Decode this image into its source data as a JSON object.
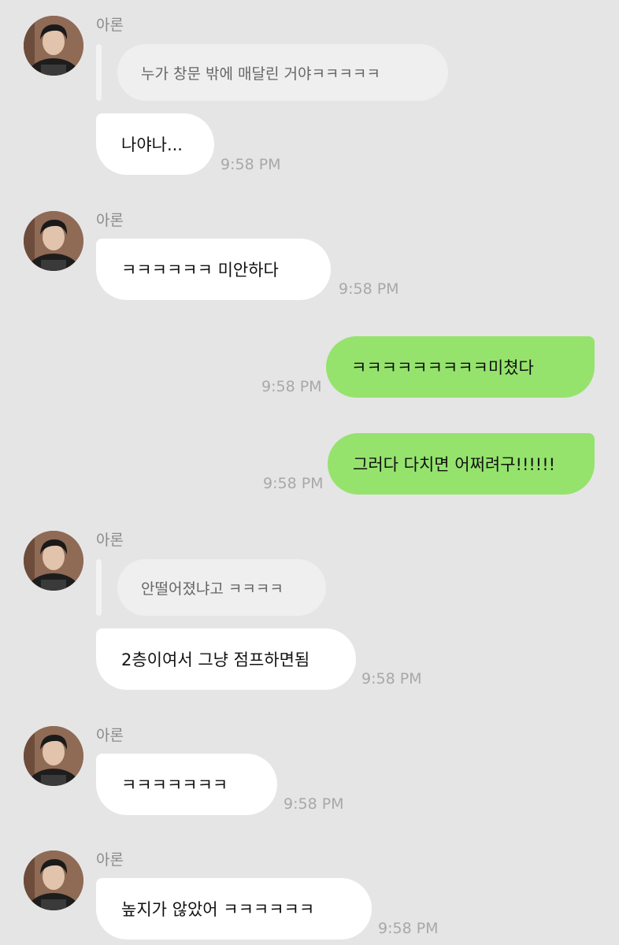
{
  "sender_name": "아론",
  "messages": [
    {
      "quote": "누가 창문 밖에 매달린 거야ㅋㅋㅋㅋㅋ",
      "text": "나야나...",
      "time": "9:58 PM"
    },
    {
      "text": "ㅋㅋㅋㅋㅋㅋ 미안하다",
      "time": "9:58 PM"
    },
    {
      "text": "ㅋㅋㅋㅋㅋㅋㅋㅋㅋ미쳤다",
      "time": "9:58 PM"
    },
    {
      "text": "그러다 다치면 어쩌려구!!!!!!",
      "time": "9:58 PM"
    },
    {
      "quote": "안떨어졌냐고 ㅋㅋㅋㅋ",
      "text": "2층이여서 그냥 점프하면됨",
      "time": "9:58 PM"
    },
    {
      "text": "ㅋㅋㅋㅋㅋㅋㅋ",
      "time": "9:58 PM"
    },
    {
      "text": "높지가 않았어 ㅋㅋㅋㅋㅋㅋ",
      "time": "9:58 PM"
    }
  ],
  "colors": {
    "background": "#e5e5e5",
    "incoming_bubble": "#ffffff",
    "outgoing_bubble": "#95e36d",
    "quote_bubble": "#efefef"
  }
}
